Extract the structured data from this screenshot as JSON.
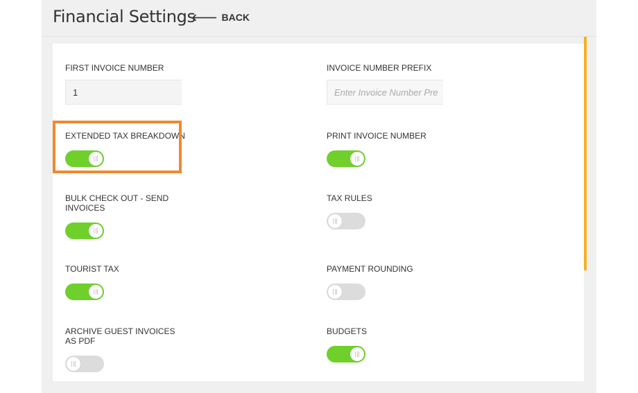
{
  "header": {
    "title": "Financial Settings",
    "back_label": "BACK"
  },
  "colors": {
    "toggle_on": "#6fd02c",
    "toggle_off": "#dcdcdc",
    "highlight": "#f0892e",
    "scrollbar": "#f5b123"
  },
  "settings": {
    "first_invoice_number": {
      "label": "FIRST INVOICE NUMBER",
      "value": "1"
    },
    "invoice_number_prefix": {
      "label": "INVOICE NUMBER PREFIX",
      "placeholder": "Enter Invoice Number Pre"
    },
    "extended_tax_breakdown": {
      "label": "EXTENDED TAX BREAKDOWN",
      "enabled": true
    },
    "print_invoice_number": {
      "label": "PRINT INVOICE NUMBER",
      "enabled": true
    },
    "bulk_check_out": {
      "label": "BULK CHECK OUT - SEND INVOICES",
      "enabled": true
    },
    "tax_rules": {
      "label": "TAX RULES",
      "enabled": false
    },
    "tourist_tax": {
      "label": "TOURIST TAX",
      "enabled": true
    },
    "payment_rounding": {
      "label": "PAYMENT ROUNDING",
      "enabled": false
    },
    "archive_guest_invoices": {
      "label": "ARCHIVE GUEST INVOICES AS PDF",
      "enabled": false
    },
    "budgets": {
      "label": "BUDGETS",
      "enabled": true
    }
  }
}
